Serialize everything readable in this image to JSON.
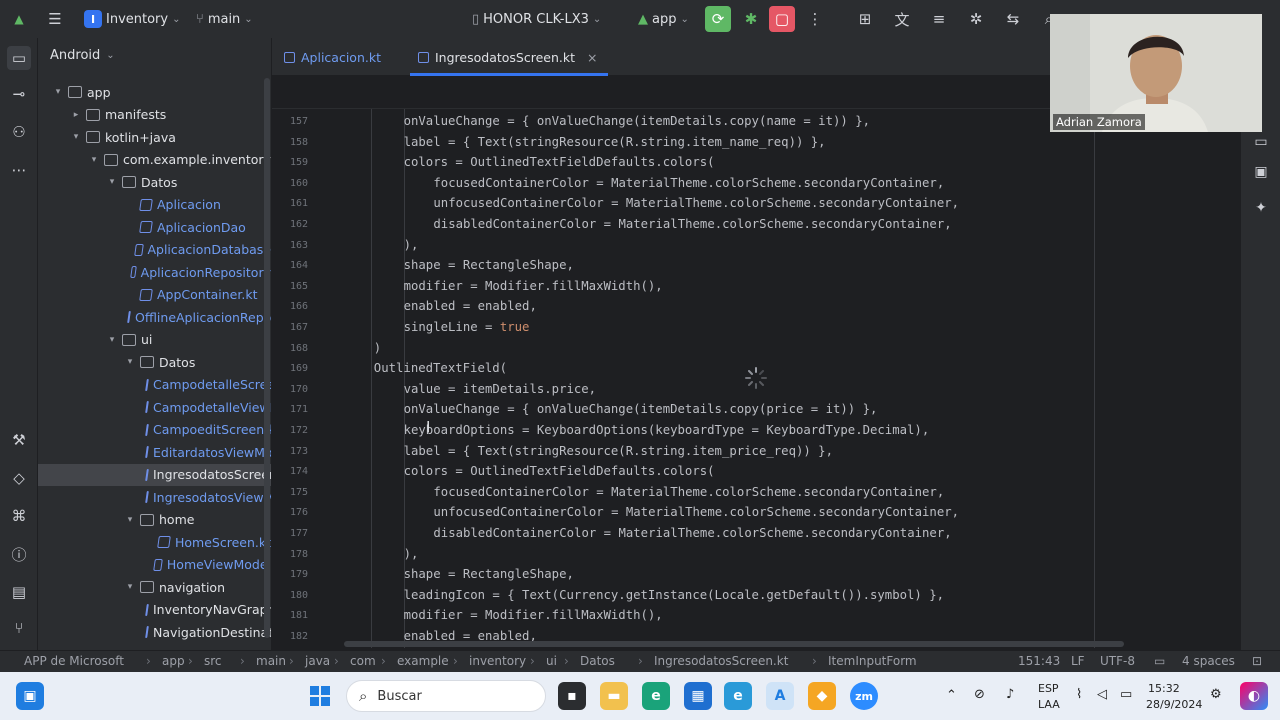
{
  "titlebar": {
    "project_badge": "I",
    "project_name": "Inventory",
    "branch": "main",
    "device": "HONOR CLK-LX3",
    "run_config": "app"
  },
  "toolwindow": {
    "view": "Android"
  },
  "tree": [
    {
      "label": "app",
      "depth": 0,
      "arrow": "down",
      "icon": "folder",
      "style": "normal"
    },
    {
      "label": "manifests",
      "depth": 1,
      "arrow": "right",
      "icon": "folder",
      "style": "normal"
    },
    {
      "label": "kotlin+java",
      "depth": 1,
      "arrow": "down",
      "icon": "folder",
      "style": "normal"
    },
    {
      "label": "com.example.inventory",
      "depth": 2,
      "arrow": "down",
      "icon": "folder",
      "style": "normal"
    },
    {
      "label": "Datos",
      "depth": 3,
      "arrow": "down",
      "icon": "folder",
      "style": "normal"
    },
    {
      "label": "Aplicacion",
      "depth": 4,
      "arrow": "",
      "icon": "kotlin",
      "style": "blue"
    },
    {
      "label": "AplicacionDao",
      "depth": 4,
      "arrow": "",
      "icon": "kotlin",
      "style": "blue"
    },
    {
      "label": "AplicacionDatabase",
      "depth": 4,
      "arrow": "",
      "icon": "kotlin",
      "style": "blue"
    },
    {
      "label": "AplicacionRepository",
      "depth": 4,
      "arrow": "",
      "icon": "kotlin",
      "style": "blue"
    },
    {
      "label": "AppContainer.kt",
      "depth": 4,
      "arrow": "",
      "icon": "kotlin",
      "style": "blue"
    },
    {
      "label": "OfflineAplicacionRepository",
      "depth": 4,
      "arrow": "",
      "icon": "kotlin",
      "style": "blue"
    },
    {
      "label": "ui",
      "depth": 3,
      "arrow": "down",
      "icon": "folder",
      "style": "normal"
    },
    {
      "label": "Datos",
      "depth": 4,
      "arrow": "down",
      "icon": "folder",
      "style": "normal"
    },
    {
      "label": "CampodetalleScreen.kt",
      "depth": 5,
      "arrow": "",
      "icon": "kotlin",
      "style": "blue"
    },
    {
      "label": "CampodetalleViewModel",
      "depth": 5,
      "arrow": "",
      "icon": "kotlin",
      "style": "blue"
    },
    {
      "label": "CampoeditScreen.kt",
      "depth": 5,
      "arrow": "",
      "icon": "kotlin",
      "style": "blue"
    },
    {
      "label": "EditardatosViewModel",
      "depth": 5,
      "arrow": "",
      "icon": "kotlin",
      "style": "blue"
    },
    {
      "label": "IngresodatosScreen.kt",
      "depth": 5,
      "arrow": "",
      "icon": "kotlin",
      "style": "selected"
    },
    {
      "label": "IngresodatosViewModel",
      "depth": 5,
      "arrow": "",
      "icon": "kotlin",
      "style": "blue"
    },
    {
      "label": "home",
      "depth": 4,
      "arrow": "down",
      "icon": "folder",
      "style": "normal"
    },
    {
      "label": "HomeScreen.kt",
      "depth": 5,
      "arrow": "",
      "icon": "kotlin",
      "style": "blue"
    },
    {
      "label": "HomeViewModel",
      "depth": 5,
      "arrow": "",
      "icon": "kotlin",
      "style": "blue"
    },
    {
      "label": "navigation",
      "depth": 4,
      "arrow": "down",
      "icon": "folder",
      "style": "normal"
    },
    {
      "label": "InventoryNavGraph.kt",
      "depth": 5,
      "arrow": "",
      "icon": "kotlin",
      "style": "normal"
    },
    {
      "label": "NavigationDestination.kt",
      "depth": 5,
      "arrow": "",
      "icon": "kotlin",
      "style": "normal"
    }
  ],
  "tabs": [
    {
      "label": "Aplicacion.kt",
      "active": false
    },
    {
      "label": "IngresodatosScreen.kt",
      "active": true,
      "close": "×"
    }
  ],
  "code": [
    {
      "n": "157",
      "indent": 8,
      "text": "onValueChange = { onValueChange(itemDetails.copy(name = it)) },"
    },
    {
      "n": "158",
      "indent": 8,
      "text": "label = { Text(stringResource(R.string.item_name_req)) },"
    },
    {
      "n": "159",
      "indent": 8,
      "text": "colors = OutlinedTextFieldDefaults.colors("
    },
    {
      "n": "160",
      "indent": 12,
      "text": "focusedContainerColor = MaterialTheme.colorScheme.secondaryContainer,"
    },
    {
      "n": "161",
      "indent": 12,
      "text": "unfocusedContainerColor = MaterialTheme.colorScheme.secondaryContainer,"
    },
    {
      "n": "162",
      "indent": 12,
      "text": "disabledContainerColor = MaterialTheme.colorScheme.secondaryContainer,"
    },
    {
      "n": "163",
      "indent": 8,
      "text": "),"
    },
    {
      "n": "164",
      "indent": 8,
      "text": "shape = RectangleShape,"
    },
    {
      "n": "165",
      "indent": 8,
      "text": "modifier = Modifier.fillMaxWidth(),"
    },
    {
      "n": "166",
      "indent": 8,
      "text": "enabled = enabled,"
    },
    {
      "n": "167",
      "indent": 8,
      "text": "singleLine = ",
      "kw": "true"
    },
    {
      "n": "168",
      "indent": 4,
      "text": ")"
    },
    {
      "n": "169",
      "indent": 4,
      "text": "OutlinedTextField("
    },
    {
      "n": "170",
      "indent": 8,
      "text": "value = itemDetails.price,"
    },
    {
      "n": "171",
      "indent": 8,
      "text": "onValueChange = { onValueChange(itemDetails.copy(price = it)) },"
    },
    {
      "n": "172",
      "indent": 8,
      "text": "keyboardOptions = KeyboardOptions(keyboardType = KeyboardType.Decimal),"
    },
    {
      "n": "173",
      "indent": 8,
      "text": "label = { Text(stringResource(R.string.item_price_req)) },"
    },
    {
      "n": "174",
      "indent": 8,
      "text": "colors = OutlinedTextFieldDefaults.colors("
    },
    {
      "n": "175",
      "indent": 12,
      "text": "focusedContainerColor = MaterialTheme.colorScheme.secondaryContainer,"
    },
    {
      "n": "176",
      "indent": 12,
      "text": "unfocusedContainerColor = MaterialTheme.colorScheme.secondaryContainer,"
    },
    {
      "n": "177",
      "indent": 12,
      "text": "disabledContainerColor = MaterialTheme.colorScheme.secondaryContainer,"
    },
    {
      "n": "178",
      "indent": 8,
      "text": "),"
    },
    {
      "n": "179",
      "indent": 8,
      "text": "shape = RectangleShape,"
    },
    {
      "n": "180",
      "indent": 8,
      "text": "leadingIcon = { Text(Currency.getInstance(Locale.getDefault()).symbol) },"
    },
    {
      "n": "181",
      "indent": 8,
      "text": "modifier = Modifier.fillMaxWidth(),"
    },
    {
      "n": "182",
      "indent": 8,
      "text": "enabled = enabled,"
    }
  ],
  "statusbar": {
    "crumbs": [
      "APP de Microsoft",
      "app",
      "src",
      "main",
      "java",
      "com",
      "example",
      "inventory",
      "ui",
      "Datos",
      "IngresodatosScreen.kt",
      "ItemInputForm"
    ],
    "position": "151:43",
    "line_sep": "LF",
    "encoding": "UTF-8",
    "indent": "4 spaces"
  },
  "taskbar": {
    "search_placeholder": "Buscar",
    "lang_top": "ESP",
    "lang_bottom": "LAA",
    "time": "15:32",
    "date": "28/9/2024"
  },
  "webcam": {
    "name": "Adrian Zamora"
  },
  "colors": {
    "accent": "#3574f0",
    "run_green": "#5fb865",
    "stop_red": "#e55765",
    "link_blue": "#6f9bf0",
    "keyword": "#cf8e6d"
  }
}
